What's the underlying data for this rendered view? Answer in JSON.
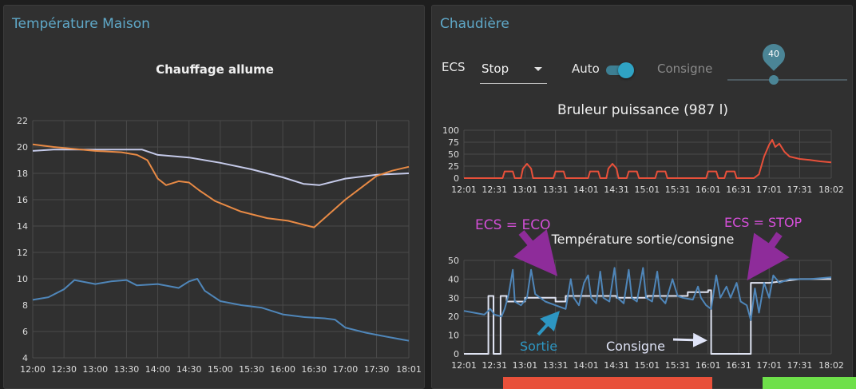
{
  "left_panel": {
    "title": "Température Maison",
    "chart_title": "Chauffage allume"
  },
  "right_panel": {
    "title": "Chaudière",
    "controls": {
      "ecs_label": "ECS",
      "ecs_value": "Stop",
      "auto_label": "Auto",
      "auto_on": true,
      "consigne_label": "Consigne",
      "consigne_value": "40"
    },
    "burner_chart_title": "Bruleur puissance (987 l)",
    "temp_chart_title": "Température sortie/consigne",
    "annotations": {
      "eco": "ECS = ECO",
      "stop": "ECS = STOP",
      "sortie": "Sortie",
      "consigne": "Consigne"
    },
    "strip_colors": {
      "red": "#e8503a",
      "green": "#6ee04a"
    }
  },
  "chart_data": [
    {
      "type": "line",
      "title": "Chauffage allume",
      "xlabel": "",
      "ylabel": "",
      "ylim": [
        4,
        22
      ],
      "yticks": [
        "4",
        "6",
        "8",
        "10",
        "12",
        "14",
        "16",
        "18",
        "20",
        "22"
      ],
      "xlim_minutes": [
        0,
        361
      ],
      "xticks": [
        {
          "label": "12:00",
          "t": 0
        },
        {
          "label": "12:30",
          "t": 30
        },
        {
          "label": "13:00",
          "t": 60
        },
        {
          "label": "13:30",
          "t": 90
        },
        {
          "label": "14:00",
          "t": 120
        },
        {
          "label": "14:30",
          "t": 150
        },
        {
          "label": "15:00",
          "t": 180
        },
        {
          "label": "15:30",
          "t": 210
        },
        {
          "label": "16:00",
          "t": 240
        },
        {
          "label": "16:30",
          "t": 270
        },
        {
          "label": "17:00",
          "t": 300
        },
        {
          "label": "17:30",
          "t": 330
        },
        {
          "label": "18:01",
          "t": 361
        }
      ],
      "grid": true,
      "series": [
        {
          "color": "#c5cae9",
          "points": [
            [
              0,
              19.7
            ],
            [
              20,
              19.8
            ],
            [
              60,
              19.8
            ],
            [
              105,
              19.8
            ],
            [
              120,
              19.4
            ],
            [
              150,
              19.2
            ],
            [
              180,
              18.8
            ],
            [
              210,
              18.3
            ],
            [
              240,
              17.7
            ],
            [
              260,
              17.2
            ],
            [
              275,
              17.1
            ],
            [
              300,
              17.6
            ],
            [
              330,
              17.9
            ],
            [
              361,
              18.0
            ]
          ]
        },
        {
          "color": "#e88a45",
          "points": [
            [
              0,
              20.2
            ],
            [
              20,
              20.0
            ],
            [
              60,
              19.7
            ],
            [
              85,
              19.6
            ],
            [
              100,
              19.4
            ],
            [
              110,
              19.0
            ],
            [
              120,
              17.6
            ],
            [
              128,
              17.1
            ],
            [
              140,
              17.4
            ],
            [
              150,
              17.3
            ],
            [
              160,
              16.7
            ],
            [
              175,
              15.9
            ],
            [
              200,
              15.1
            ],
            [
              225,
              14.6
            ],
            [
              245,
              14.4
            ],
            [
              265,
              14.0
            ],
            [
              270,
              13.9
            ],
            [
              280,
              14.6
            ],
            [
              300,
              16.0
            ],
            [
              315,
              16.9
            ],
            [
              330,
              17.8
            ],
            [
              345,
              18.2
            ],
            [
              361,
              18.5
            ]
          ]
        },
        {
          "color": "#4f86b9",
          "points": [
            [
              0,
              8.4
            ],
            [
              15,
              8.6
            ],
            [
              30,
              9.2
            ],
            [
              40,
              9.9
            ],
            [
              60,
              9.6
            ],
            [
              75,
              9.8
            ],
            [
              90,
              9.9
            ],
            [
              100,
              9.5
            ],
            [
              120,
              9.6
            ],
            [
              140,
              9.3
            ],
            [
              150,
              9.8
            ],
            [
              158,
              10.0
            ],
            [
              165,
              9.1
            ],
            [
              180,
              8.3
            ],
            [
              200,
              8.0
            ],
            [
              220,
              7.8
            ],
            [
              240,
              7.3
            ],
            [
              260,
              7.1
            ],
            [
              280,
              7.0
            ],
            [
              290,
              6.9
            ],
            [
              300,
              6.3
            ],
            [
              320,
              5.9
            ],
            [
              340,
              5.6
            ],
            [
              361,
              5.3
            ]
          ]
        }
      ]
    },
    {
      "type": "line",
      "title": "Bruleur puissance (987 l)",
      "ylim": [
        0,
        100
      ],
      "yticks": [
        "0",
        "25",
        "50",
        "75",
        "100"
      ],
      "xlim_minutes": [
        0,
        361
      ],
      "xticks": [
        {
          "label": "12:01",
          "t": 0
        },
        {
          "label": "12:31",
          "t": 30
        },
        {
          "label": "13:01",
          "t": 60
        },
        {
          "label": "13:31",
          "t": 90
        },
        {
          "label": "14:01",
          "t": 120
        },
        {
          "label": "14:31",
          "t": 150
        },
        {
          "label": "15:01",
          "t": 180
        },
        {
          "label": "15:31",
          "t": 210
        },
        {
          "label": "16:01",
          "t": 240
        },
        {
          "label": "16:31",
          "t": 270
        },
        {
          "label": "17:01",
          "t": 300
        },
        {
          "label": "17:31",
          "t": 330
        },
        {
          "label": "18:02",
          "t": 361
        }
      ],
      "grid": true,
      "series": [
        {
          "color": "#e8503a",
          "points": [
            [
              0,
              0
            ],
            [
              38,
              0
            ],
            [
              40,
              14
            ],
            [
              48,
              14
            ],
            [
              50,
              0
            ],
            [
              56,
              0
            ],
            [
              58,
              20
            ],
            [
              62,
              30
            ],
            [
              66,
              20
            ],
            [
              68,
              0
            ],
            [
              88,
              0
            ],
            [
              90,
              14
            ],
            [
              98,
              14
            ],
            [
              100,
              0
            ],
            [
              122,
              0
            ],
            [
              124,
              14
            ],
            [
              132,
              14
            ],
            [
              134,
              0
            ],
            [
              140,
              0
            ],
            [
              142,
              20
            ],
            [
              146,
              30
            ],
            [
              150,
              20
            ],
            [
              152,
              0
            ],
            [
              160,
              0
            ],
            [
              162,
              14
            ],
            [
              170,
              14
            ],
            [
              172,
              0
            ],
            [
              188,
              0
            ],
            [
              190,
              14
            ],
            [
              198,
              14
            ],
            [
              200,
              0
            ],
            [
              238,
              0
            ],
            [
              240,
              14
            ],
            [
              248,
              14
            ],
            [
              250,
              0
            ],
            [
              256,
              0
            ],
            [
              258,
              14
            ],
            [
              266,
              14
            ],
            [
              268,
              0
            ],
            [
              285,
              0
            ],
            [
              290,
              8
            ],
            [
              295,
              45
            ],
            [
              300,
              70
            ],
            [
              303,
              80
            ],
            [
              306,
              65
            ],
            [
              310,
              72
            ],
            [
              315,
              55
            ],
            [
              320,
              45
            ],
            [
              330,
              40
            ],
            [
              340,
              38
            ],
            [
              350,
              35
            ],
            [
              361,
              33
            ]
          ]
        }
      ]
    },
    {
      "type": "line",
      "title": "Température sortie/consigne",
      "ylim": [
        0,
        50
      ],
      "yticks": [
        "0",
        "10",
        "20",
        "30",
        "40",
        "50"
      ],
      "xlim_minutes": [
        0,
        361
      ],
      "xticks": [
        {
          "label": "12:01",
          "t": 0
        },
        {
          "label": "12:31",
          "t": 30
        },
        {
          "label": "13:01",
          "t": 60
        },
        {
          "label": "13:31",
          "t": 90
        },
        {
          "label": "14:01",
          "t": 120
        },
        {
          "label": "14:31",
          "t": 150
        },
        {
          "label": "15:01",
          "t": 180
        },
        {
          "label": "15:31",
          "t": 210
        },
        {
          "label": "16:01",
          "t": 240
        },
        {
          "label": "16:31",
          "t": 270
        },
        {
          "label": "17:01",
          "t": 300
        },
        {
          "label": "17:31",
          "t": 330
        },
        {
          "label": "18:02",
          "t": 361
        }
      ],
      "grid": true,
      "series": [
        {
          "name": "Consigne",
          "color": "#dfe3f2",
          "points": [
            [
              0,
              0
            ],
            [
              24,
              0
            ],
            [
              24,
              31
            ],
            [
              29,
              31
            ],
            [
              29,
              0
            ],
            [
              36,
              0
            ],
            [
              36,
              31
            ],
            [
              42,
              31
            ],
            [
              42,
              28
            ],
            [
              60,
              28
            ],
            [
              60,
              30
            ],
            [
              90,
              30
            ],
            [
              90,
              28
            ],
            [
              100,
              28
            ],
            [
              100,
              31
            ],
            [
              150,
              31
            ],
            [
              150,
              30
            ],
            [
              180,
              30
            ],
            [
              180,
              31
            ],
            [
              220,
              31
            ],
            [
              220,
              33
            ],
            [
              240,
              33
            ],
            [
              240,
              34
            ],
            [
              243,
              34
            ],
            [
              243,
              0
            ],
            [
              282,
              0
            ],
            [
              282,
              38
            ],
            [
              300,
              38
            ],
            [
              330,
              40
            ],
            [
              361,
              40
            ]
          ]
        },
        {
          "name": "Sortie",
          "color": "#4f86b9",
          "points": [
            [
              0,
              23
            ],
            [
              10,
              22
            ],
            [
              20,
              21
            ],
            [
              26,
              24
            ],
            [
              30,
              21
            ],
            [
              37,
              20
            ],
            [
              40,
              24
            ],
            [
              44,
              32
            ],
            [
              48,
              45
            ],
            [
              50,
              28
            ],
            [
              56,
              26
            ],
            [
              62,
              30
            ],
            [
              66,
              45
            ],
            [
              70,
              32
            ],
            [
              80,
              28
            ],
            [
              90,
              26
            ],
            [
              100,
              24
            ],
            [
              105,
              40
            ],
            [
              108,
              30
            ],
            [
              113,
              26
            ],
            [
              118,
              38
            ],
            [
              122,
              42
            ],
            [
              125,
              30
            ],
            [
              130,
              27
            ],
            [
              134,
              44
            ],
            [
              137,
              30
            ],
            [
              143,
              28
            ],
            [
              148,
              46
            ],
            [
              151,
              30
            ],
            [
              157,
              27
            ],
            [
              162,
              45
            ],
            [
              165,
              30
            ],
            [
              170,
              28
            ],
            [
              176,
              46
            ],
            [
              179,
              30
            ],
            [
              185,
              28
            ],
            [
              190,
              44
            ],
            [
              193,
              30
            ],
            [
              198,
              27
            ],
            [
              205,
              40
            ],
            [
              210,
              31
            ],
            [
              215,
              30
            ],
            [
              225,
              29
            ],
            [
              230,
              36
            ],
            [
              233,
              30
            ],
            [
              238,
              26
            ],
            [
              243,
              24
            ],
            [
              248,
              42
            ],
            [
              252,
              30
            ],
            [
              258,
              36
            ],
            [
              262,
              30
            ],
            [
              268,
              38
            ],
            [
              272,
              28
            ],
            [
              278,
              26
            ],
            [
              282,
              18
            ],
            [
              286,
              35
            ],
            [
              290,
              22
            ],
            [
              295,
              38
            ],
            [
              300,
              30
            ],
            [
              304,
              42
            ],
            [
              310,
              38
            ],
            [
              320,
              40
            ],
            [
              340,
              40
            ],
            [
              361,
              41
            ]
          ]
        }
      ]
    }
  ]
}
